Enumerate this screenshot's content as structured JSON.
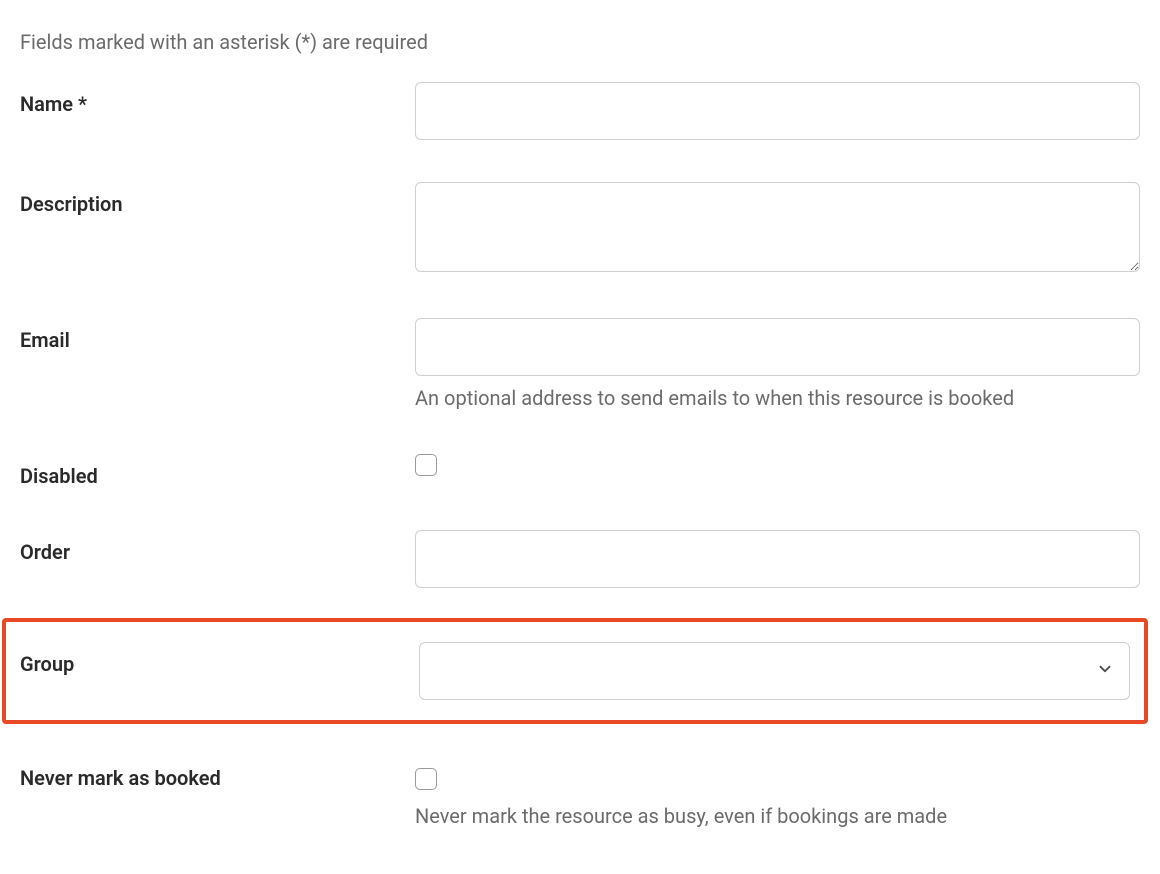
{
  "hint": "Fields marked with an asterisk (*) are required",
  "fields": {
    "name": {
      "label": "Name *",
      "value": ""
    },
    "description": {
      "label": "Description",
      "value": ""
    },
    "email": {
      "label": "Email",
      "value": "",
      "help": "An optional address to send emails to when this resource is booked"
    },
    "disabled": {
      "label": "Disabled",
      "checked": false
    },
    "order": {
      "label": "Order",
      "value": ""
    },
    "group": {
      "label": "Group",
      "value": ""
    },
    "never_booked": {
      "label": "Never mark as booked",
      "checked": false,
      "help": "Never mark the resource as busy, even if bookings are made"
    }
  }
}
